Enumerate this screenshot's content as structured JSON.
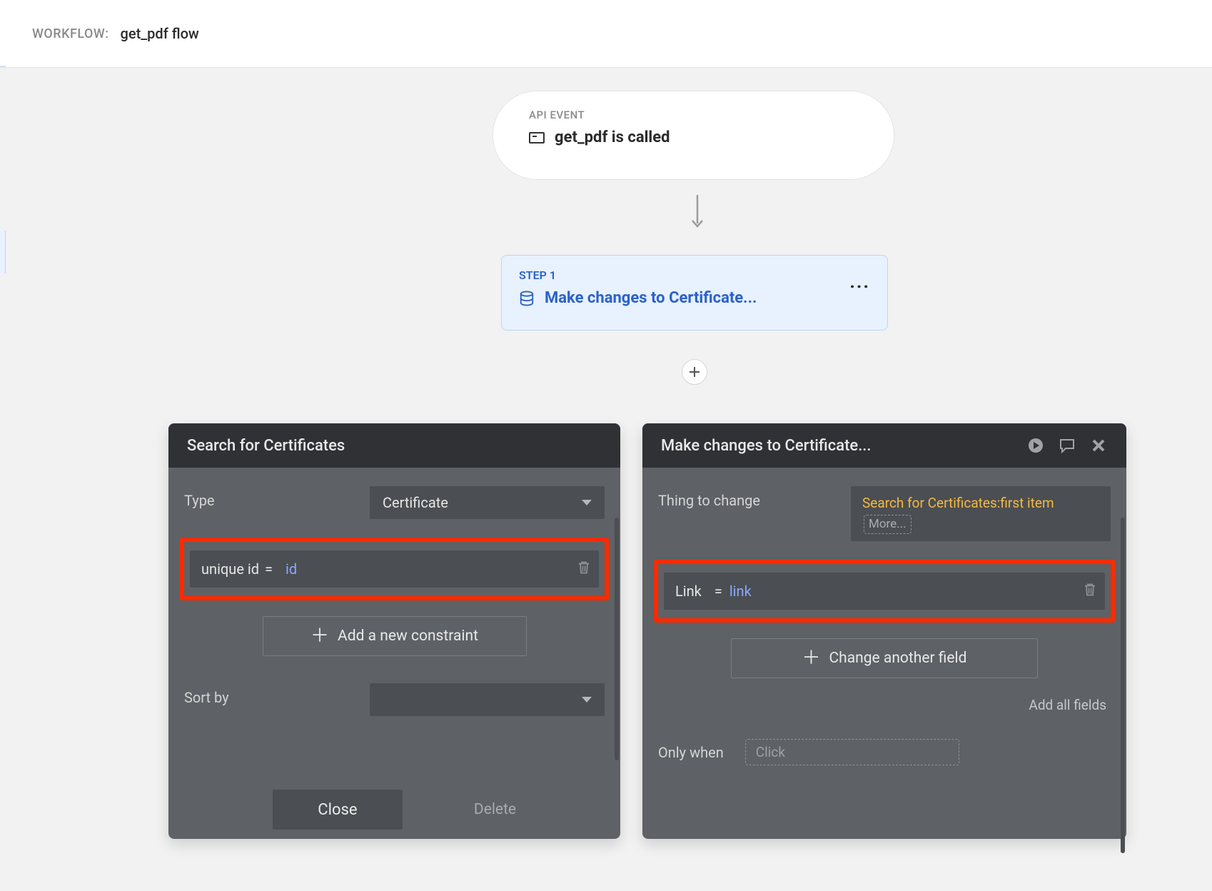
{
  "header": {
    "label": "WORKFLOW:",
    "value": "get_pdf flow"
  },
  "event": {
    "badge": "API EVENT",
    "title": "get_pdf is called"
  },
  "step": {
    "badge": "STEP 1",
    "title": "Make changes to Certificate..."
  },
  "panel_search": {
    "title": "Search for Certificates",
    "type_label": "Type",
    "type_value": "Certificate",
    "constraint_field": "unique id",
    "constraint_op": "=",
    "constraint_value": "id",
    "add_constraint": "Add a new constraint",
    "sort_label": "Sort by",
    "close": "Close",
    "delete": "Delete"
  },
  "panel_change": {
    "title": "Make changes to Certificate...",
    "thing_label": "Thing to change",
    "thing_expr": "Search for Certificates:first item",
    "thing_more": "More...",
    "field_name": "Link",
    "field_op": "=",
    "field_value": "link",
    "change_another": "Change another field",
    "add_all": "Add all fields",
    "only_when": "Only when",
    "click": "Click"
  }
}
